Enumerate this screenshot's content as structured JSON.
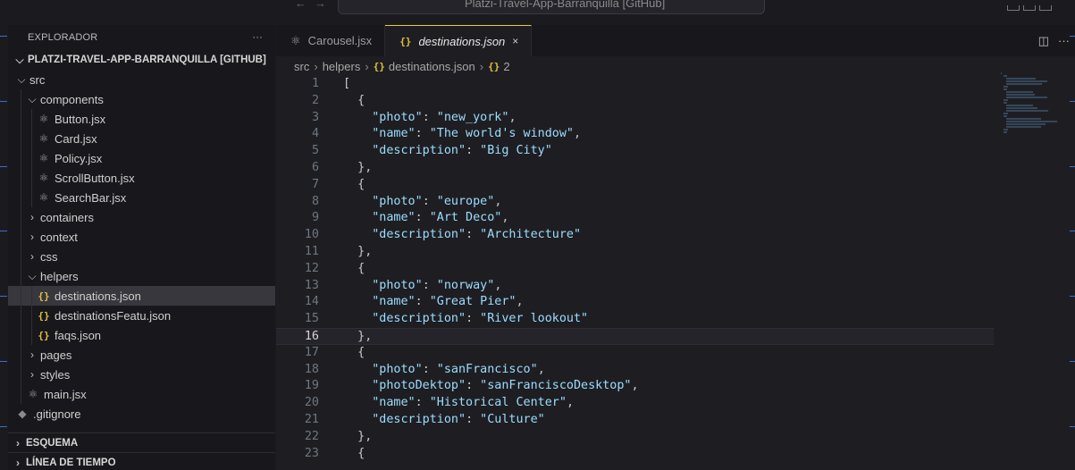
{
  "window": {
    "title": "Platzi-Travel-App-Barranquilla [GitHub]"
  },
  "explorer": {
    "header": "EXPLORADOR",
    "more_label": "···",
    "repo": "PLATZI-TRAVEL-APP-BARRANQUILLA [GITHUB]",
    "tree": [
      {
        "label": "src",
        "type": "folder-open",
        "depth": 1
      },
      {
        "label": "components",
        "type": "folder-open",
        "depth": 2
      },
      {
        "label": "Button.jsx",
        "type": "react",
        "depth": 3
      },
      {
        "label": "Card.jsx",
        "type": "react",
        "depth": 3
      },
      {
        "label": "Policy.jsx",
        "type": "react",
        "depth": 3
      },
      {
        "label": "ScrollButton.jsx",
        "type": "react",
        "depth": 3
      },
      {
        "label": "SearchBar.jsx",
        "type": "react",
        "depth": 3
      },
      {
        "label": "containers",
        "type": "folder",
        "depth": 2
      },
      {
        "label": "context",
        "type": "folder",
        "depth": 2
      },
      {
        "label": "css",
        "type": "folder",
        "depth": 2
      },
      {
        "label": "helpers",
        "type": "folder-open",
        "depth": 2
      },
      {
        "label": "destinations.json",
        "type": "json",
        "depth": 3,
        "selected": true
      },
      {
        "label": "destinationsFeatu.json",
        "type": "json",
        "depth": 3
      },
      {
        "label": "faqs.json",
        "type": "json",
        "depth": 3
      },
      {
        "label": "pages",
        "type": "folder",
        "depth": 2
      },
      {
        "label": "styles",
        "type": "folder",
        "depth": 2
      },
      {
        "label": "main.jsx",
        "type": "react",
        "depth": 2
      },
      {
        "label": ".gitignore",
        "type": "git",
        "depth": 1
      }
    ],
    "sections": [
      "ESQUEMA",
      "LÍNEA DE TIEMPO"
    ]
  },
  "tabs": [
    {
      "label": "Carousel.jsx",
      "icon": "react-icon",
      "active": false
    },
    {
      "label": "destinations.json",
      "icon": "json-icon",
      "active": true,
      "close": "×"
    }
  ],
  "breadcrumb": {
    "parts": [
      "src",
      "helpers",
      "destinations.json",
      "2"
    ]
  },
  "editor": {
    "current_line": 16,
    "lines": [
      {
        "n": "1",
        "code": "["
      },
      {
        "n": "2",
        "code": "  {"
      },
      {
        "n": "3",
        "code": "    \"photo\": \"new_york\","
      },
      {
        "n": "4",
        "code": "    \"name\": \"The world's window\","
      },
      {
        "n": "5",
        "code": "    \"description\": \"Big City\""
      },
      {
        "n": "6",
        "code": "  },"
      },
      {
        "n": "7",
        "code": "  {"
      },
      {
        "n": "8",
        "code": "    \"photo\": \"europe\","
      },
      {
        "n": "9",
        "code": "    \"name\": \"Art Deco\","
      },
      {
        "n": "10",
        "code": "    \"description\": \"Architecture\""
      },
      {
        "n": "11",
        "code": "  },"
      },
      {
        "n": "12",
        "code": "  {"
      },
      {
        "n": "13",
        "code": "    \"photo\": \"norway\","
      },
      {
        "n": "14",
        "code": "    \"name\": \"Great Pier\","
      },
      {
        "n": "15",
        "code": "    \"description\": \"River lookout\""
      },
      {
        "n": "16",
        "code": "  },"
      },
      {
        "n": "17",
        "code": "  {"
      },
      {
        "n": "18",
        "code": "    \"photo\": \"sanFrancisco\","
      },
      {
        "n": "19",
        "code": "    \"photoDektop\": \"sanFranciscoDesktop\","
      },
      {
        "n": "20",
        "code": "    \"name\": \"Historical Center\","
      },
      {
        "n": "21",
        "code": "    \"description\": \"Culture\""
      },
      {
        "n": "22",
        "code": "  },"
      },
      {
        "n": "23",
        "code": "  {"
      }
    ]
  },
  "colors": {
    "accent": "#e6c94a",
    "json_icon": "#e2c040",
    "key": "#9cdcfe",
    "bg": "#1e1e22"
  }
}
